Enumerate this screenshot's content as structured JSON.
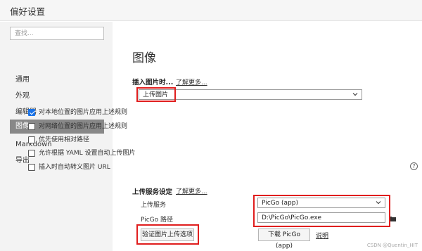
{
  "window": {
    "title": "偏好设置"
  },
  "sidebar": {
    "search_placeholder": "查找...",
    "items": [
      {
        "label": "通用",
        "active": false
      },
      {
        "label": "外观",
        "active": false
      },
      {
        "label": "编辑器",
        "active": false
      },
      {
        "label": "图像",
        "active": true
      },
      {
        "label": "Markdown",
        "active": false
      },
      {
        "label": "导出",
        "active": false
      }
    ]
  },
  "main": {
    "heading": "图像",
    "insert_section": {
      "label": "插入图片时...",
      "learn_more": "了解更多...",
      "selected_option": "上传图片",
      "checkboxes": [
        {
          "label": "对本地位置的图片应用上述规则",
          "checked": true
        },
        {
          "label": "对网络位置的图片应用上述规则",
          "checked": false
        },
        {
          "label": "优先使用相对路径",
          "checked": false
        },
        {
          "label": "允许根据 YAML 设置自动上传图片",
          "checked": false
        },
        {
          "label": "插入时自动转义图片 URL",
          "checked": false
        }
      ],
      "help_icon": "?"
    },
    "upload_section": {
      "label": "上传服务设定",
      "learn_more": "了解更多...",
      "service_label": "上传服务",
      "service_value": "PicGo (app)",
      "path_label": "PicGo 路径",
      "path_value": "D:\\PicGo\\PicGo.exe",
      "verify_button": "验证图片上传选项",
      "download_button": "下载 PicGo (app)",
      "explain_link": "说明"
    }
  },
  "watermark": "CSDN @Quentin_HIT",
  "colors": {
    "highlight_box": "#e01e1e",
    "active_nav": "#888888",
    "checkbox_checked": "#1a73e8"
  }
}
